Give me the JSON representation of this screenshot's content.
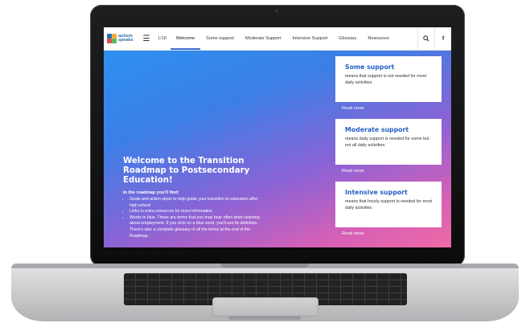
{
  "brand": {
    "line1": "autism",
    "line2": "speaks",
    "colors": [
      "#2a6fb0",
      "#f2a93b",
      "#d9534f",
      "#5cb85c"
    ]
  },
  "nav": {
    "page_indicator": "1/18",
    "items": [
      "Welcome",
      "Some support",
      "Moderate Support",
      "Intensive Support",
      "Glossary",
      "Resources"
    ],
    "active_index": 0,
    "icons": [
      "search-icon",
      "facebook-icon"
    ]
  },
  "hero": {
    "title": "Welcome to the Transition Roadmap to Postsecondary Education!",
    "subtitle": "In the roadmap you'll find:",
    "bullets": [
      "Goals and action steps to help guide your transition to education after high school",
      "Links to extra resources for more information",
      "Words in blue. These are terms that you may hear often when learning about employment. If you click on a blue word, you'll see its definition. There's also a complete glossary of all the terms at the end of the Roadmap."
    ]
  },
  "cards": [
    {
      "title": "Some support",
      "description": "means that support is not needed for most daily activities.",
      "link": "Read more"
    },
    {
      "title": "Moderate support",
      "description": "means daily support is needed for some but not all daily activities.",
      "link": "Read more"
    },
    {
      "title": "Intensive support",
      "description": "means that hourly support is needed for most daily activities.",
      "link": "Read more"
    }
  ],
  "pager": {
    "next": "→"
  },
  "colors": {
    "accent": "#2660c4",
    "gradient_start": "#2e8ff0",
    "gradient_end": "#ef6aa6"
  }
}
